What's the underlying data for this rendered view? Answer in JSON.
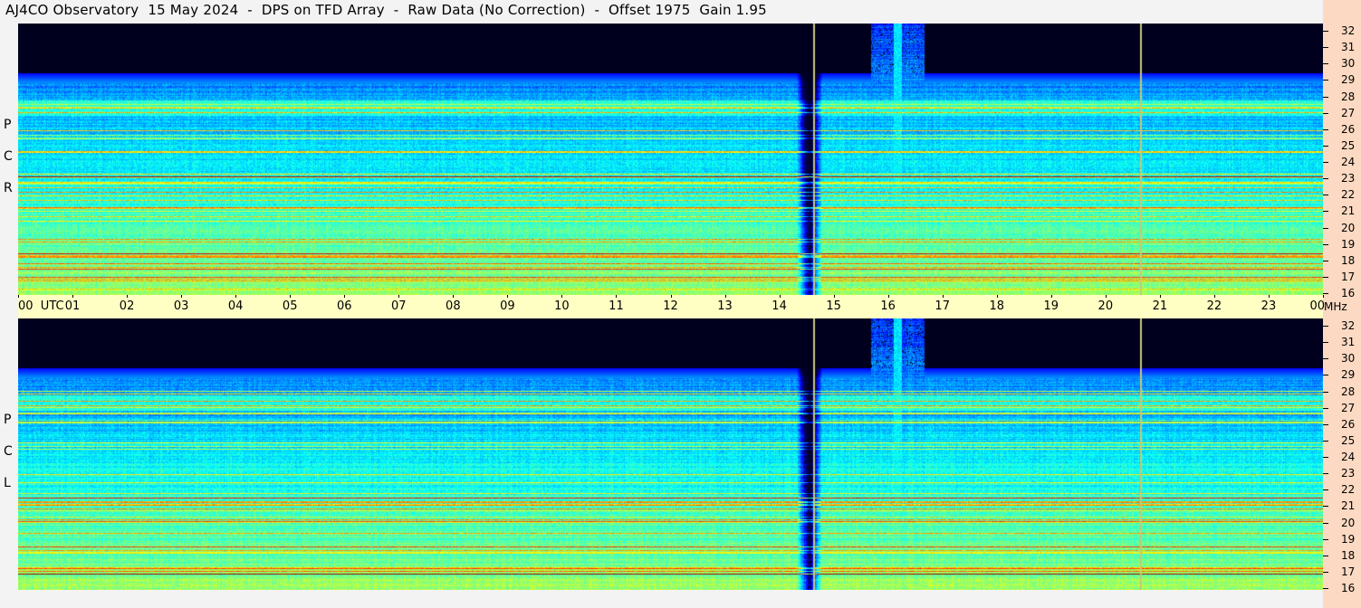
{
  "title": "AJ4CO Observatory  15 May 2024  -  DPS on TFD Array  -  Raw Data (No Correction)  -  Offset 1975  Gain 1.95",
  "panels": [
    {
      "polarization": "RCP",
      "letters": [
        "P",
        "C",
        "R"
      ]
    },
    {
      "polarization": "LCP",
      "letters": [
        "P",
        "C",
        "L"
      ]
    }
  ],
  "time_axis": {
    "labels": [
      "00  UTC",
      "01",
      "02",
      "03",
      "04",
      "05",
      "06",
      "07",
      "08",
      "09",
      "10",
      "11",
      "12",
      "13",
      "14",
      "15",
      "16",
      "17",
      "18",
      "19",
      "20",
      "21",
      "22",
      "23",
      "00"
    ],
    "unit": "MHz"
  },
  "chart_data": {
    "type": "heatmap",
    "title": "AJ4CO Observatory  15 May 2024  -  DPS on TFD Array  -  Raw Data (No Correction)  -  Offset 1975  Gain 1.95",
    "x": {
      "label": "UTC",
      "range": [
        0,
        24
      ],
      "ticks": [
        "00",
        "01",
        "02",
        "03",
        "04",
        "05",
        "06",
        "07",
        "08",
        "09",
        "10",
        "11",
        "12",
        "13",
        "14",
        "15",
        "16",
        "17",
        "18",
        "19",
        "20",
        "21",
        "22",
        "23",
        "00"
      ]
    },
    "y": {
      "label": "MHz",
      "range": [
        16,
        32
      ],
      "ticks": [
        16,
        17,
        18,
        19,
        20,
        21,
        22,
        23,
        24,
        25,
        26,
        27,
        28,
        29,
        30,
        31,
        32
      ]
    },
    "series": [
      {
        "name": "RCP",
        "colormap": "jet",
        "dark_stripe_utc": 14.55,
        "vertical_markers_utc": [
          14.63,
          20.63
        ],
        "bright_burst_utc": [
          16.1,
          16.25
        ]
      },
      {
        "name": "LCP",
        "colormap": "jet",
        "dark_stripe_utc": 14.55,
        "vertical_markers_utc": [
          14.63,
          20.63
        ],
        "bright_burst_utc": [
          16.1,
          16.25
        ]
      }
    ]
  },
  "colors": {
    "background": "#f3f3f3",
    "time_axis_bg": "#ffffc4",
    "freq_axis_bg": "#fbd9c2",
    "marker": "#c8c878"
  }
}
